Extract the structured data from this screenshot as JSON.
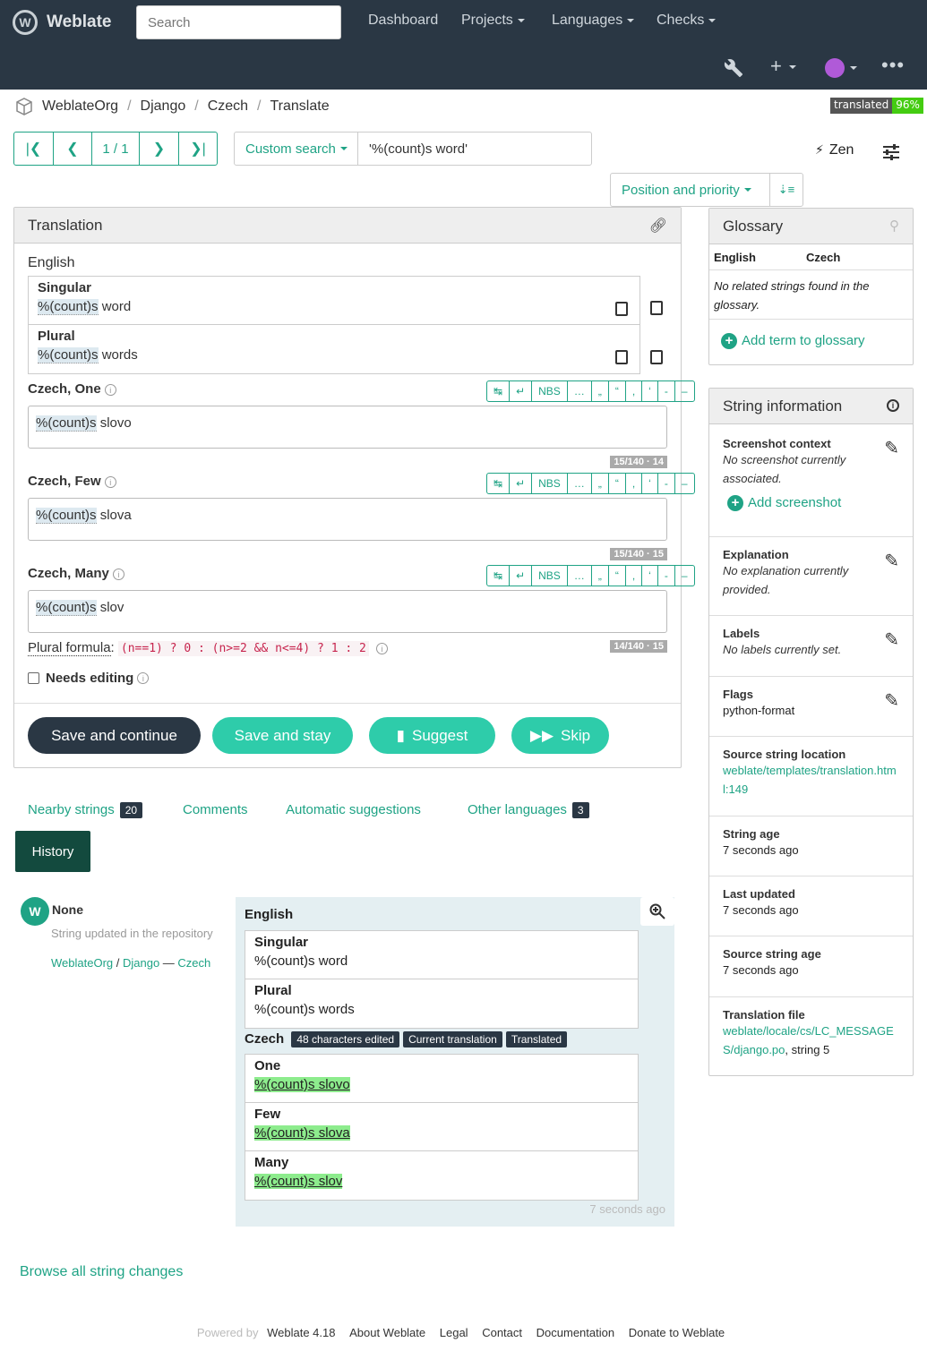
{
  "nav": {
    "brand": "Weblate",
    "search_placeholder": "Search",
    "items": [
      "Dashboard",
      "Projects",
      "Languages",
      "Checks"
    ]
  },
  "breadcrumb": [
    "WeblateOrg",
    "Django",
    "Czech",
    "Translate"
  ],
  "badge": {
    "label": "translated",
    "value": "96%"
  },
  "pager": {
    "position": "1 / 1"
  },
  "search": {
    "dropdown": "Custom search",
    "query": "'%(count)s word'"
  },
  "zen": "Zen",
  "sort": {
    "label": "Position and priority"
  },
  "translation": {
    "title": "Translation",
    "source_lang": "English",
    "source": [
      {
        "label": "Singular",
        "placeholder": "%(count)s",
        "rest": " word"
      },
      {
        "label": "Plural",
        "placeholder": "%(count)s",
        "rest": " words"
      }
    ],
    "specials": [
      "↹",
      "↵",
      "NBS",
      "…",
      "„",
      "“",
      ",",
      "‘",
      "-",
      "–"
    ],
    "targets": [
      {
        "label": "Czech, One",
        "placeholder": "%(count)s",
        "rest": " slovo",
        "counter": "15/140 · 14"
      },
      {
        "label": "Czech, Few",
        "placeholder": "%(count)s",
        "rest": " slova",
        "counter": "15/140 · 15"
      },
      {
        "label": "Czech, Many",
        "placeholder": "%(count)s",
        "rest": " slov",
        "counter": "14/140 · 15"
      }
    ],
    "plural_formula_label": "Plural formula",
    "plural_formula": "(n==1) ? 0 : (n>=2 && n<=4) ? 1 : 2",
    "needs_editing": "Needs editing",
    "buttons": {
      "save_continue": "Save and continue",
      "save_stay": "Save and stay",
      "suggest": "Suggest",
      "skip": "Skip"
    }
  },
  "tabs": {
    "nearby": "Nearby strings",
    "nearby_count": "20",
    "comments": "Comments",
    "auto": "Automatic suggestions",
    "other": "Other languages",
    "other_count": "3",
    "history": "History"
  },
  "history": {
    "user": "None",
    "action": "String updated in the repository",
    "project": "WeblateOrg",
    "component": "Django",
    "language": "Czech",
    "source_lang": "English",
    "source": [
      {
        "label": "Singular",
        "text": "%(count)s word"
      },
      {
        "label": "Plural",
        "text": "%(count)s words"
      }
    ],
    "target_lang": "Czech",
    "badges": [
      "48 characters edited",
      "Current translation",
      "Translated"
    ],
    "target": [
      {
        "label": "One",
        "text": "%(count)s slovo"
      },
      {
        "label": "Few",
        "text": "%(count)s slova"
      },
      {
        "label": "Many",
        "text": "%(count)s slov"
      }
    ],
    "time": "7 seconds ago",
    "browse": "Browse all string changes"
  },
  "glossary": {
    "title": "Glossary",
    "col_source": "English",
    "col_target": "Czech",
    "empty": "No related strings found in the glossary.",
    "add": "Add term to glossary"
  },
  "info": {
    "title": "String information",
    "screenshot_h": "Screenshot context",
    "screenshot_v": "No screenshot currently associated.",
    "add_screenshot": "Add screenshot",
    "explanation_h": "Explanation",
    "explanation_v": "No explanation currently provided.",
    "labels_h": "Labels",
    "labels_v": "No labels currently set.",
    "flags_h": "Flags",
    "flags_v": "python-format",
    "location_h": "Source string location",
    "location_v": "weblate/templates/translation.html:149",
    "age_h": "String age",
    "age_v": "7 seconds ago",
    "updated_h": "Last updated",
    "updated_v": "7 seconds ago",
    "src_age_h": "Source string age",
    "src_age_v": "7 seconds ago",
    "file_h": "Translation file",
    "file_link": "weblate/locale/cs/LC_MESSAGES/django.po",
    "file_rest": ", string 5"
  },
  "footer": {
    "powered": "Powered by",
    "links": [
      "Weblate 4.18",
      "About Weblate",
      "Legal",
      "Contact",
      "Documentation",
      "Donate to Weblate"
    ]
  },
  "colors": {
    "navbar": "#2a3744",
    "accent": "#1fa385",
    "history_tab": "#134a3e"
  }
}
